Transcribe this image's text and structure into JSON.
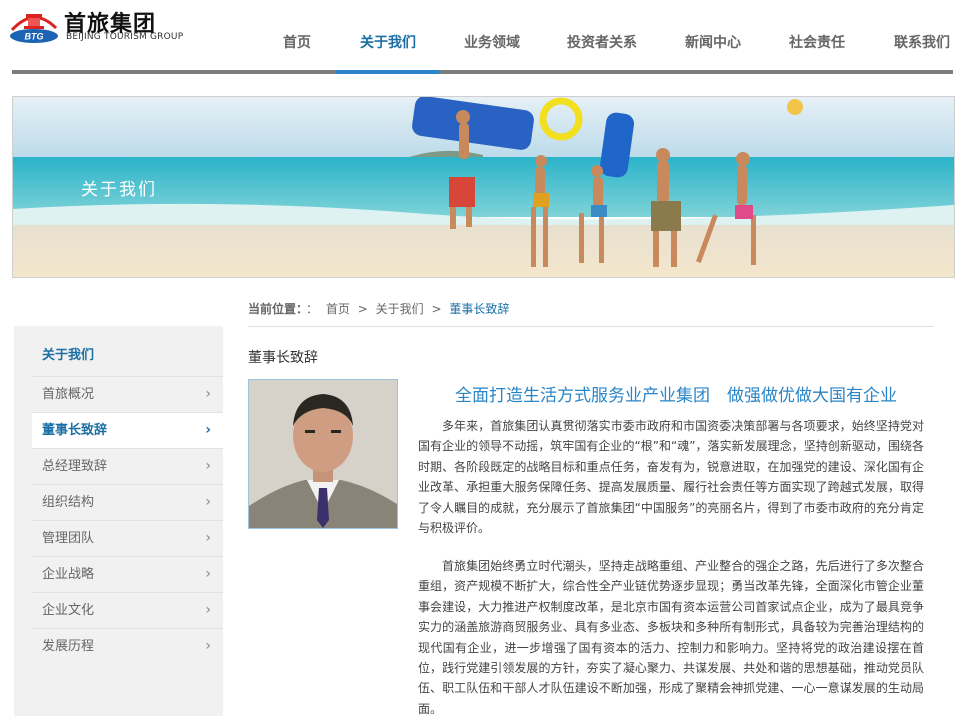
{
  "logo": {
    "mark_text": "BTG",
    "name_cn": "首旅集团",
    "name_en": "BEIJING TOURISM GROUP"
  },
  "nav": {
    "items": [
      {
        "label": "首页"
      },
      {
        "label": "关于我们"
      },
      {
        "label": "业务领域"
      },
      {
        "label": "投资者关系"
      },
      {
        "label": "新闻中心"
      },
      {
        "label": "社会责任"
      },
      {
        "label": "联系我们"
      }
    ],
    "active_index": 1
  },
  "banner": {
    "title": "关于我们"
  },
  "sidebar": {
    "title": "关于我们",
    "items": [
      {
        "label": "首旅概况"
      },
      {
        "label": "董事长致辞"
      },
      {
        "label": "总经理致辞"
      },
      {
        "label": "组织结构"
      },
      {
        "label": "管理团队"
      },
      {
        "label": "企业战略"
      },
      {
        "label": "企业文化"
      },
      {
        "label": "发展历程"
      }
    ],
    "active_index": 1,
    "chevron": "›"
  },
  "breadcrumb": {
    "label": "当前位置：",
    "sep0": "：",
    "home": "首页",
    "sep": ">",
    "parent": "关于我们",
    "current": "董事长致辞"
  },
  "section_title": "董事长致辞",
  "article": {
    "title": "全面打造生活方式服务业产业集团　做强做优做大国有企业",
    "paragraphs": [
      "多年来，首旅集团认真贯彻落实市委市政府和市国资委决策部署与各项要求，始终坚持党对国有企业的领导不动摇，筑牢国有企业的“根”和“魂”，落实新发展理念，坚持创新驱动，围绕各时期、各阶段既定的战略目标和重点任务，奋发有为，锐意进取，在加强党的建设、深化国有企业改革、承担重大服务保障任务、提高发展质量、履行社会责任等方面实现了跨越式发展，取得了令人瞩目的成就，充分展示了首旅集团“中国服务”的亮丽名片，得到了市委市政府的充分肯定与积极评价。",
      "首旅集团始终勇立时代潮头，坚持走战略重组、产业整合的强企之路，先后进行了多次整合重组，资产规模不断扩大，综合性全产业链优势逐步显现；勇当改革先锋，全面深化市管企业董事会建设，大力推进产权制度改革，是北京市国有资本运营公司首家试点企业，成为了最具竞争实力的涵盖旅游商贸服务业、具有多业态、多板块和多种所有制形式，具备较为完善治理结构的现代国有企业，进一步增强了国有资本的活力、控制力和影响力。坚持将党的政治建设摆在首位，践行党建引领发展的方针，夯实了凝心聚力、共谋发展、共处和谐的思想基础，推动党员队伍、职工队伍和干部人才队伍建设不断加强，形成了聚精会神抓党建、一心一意谋发展的生动局面。"
    ]
  }
}
